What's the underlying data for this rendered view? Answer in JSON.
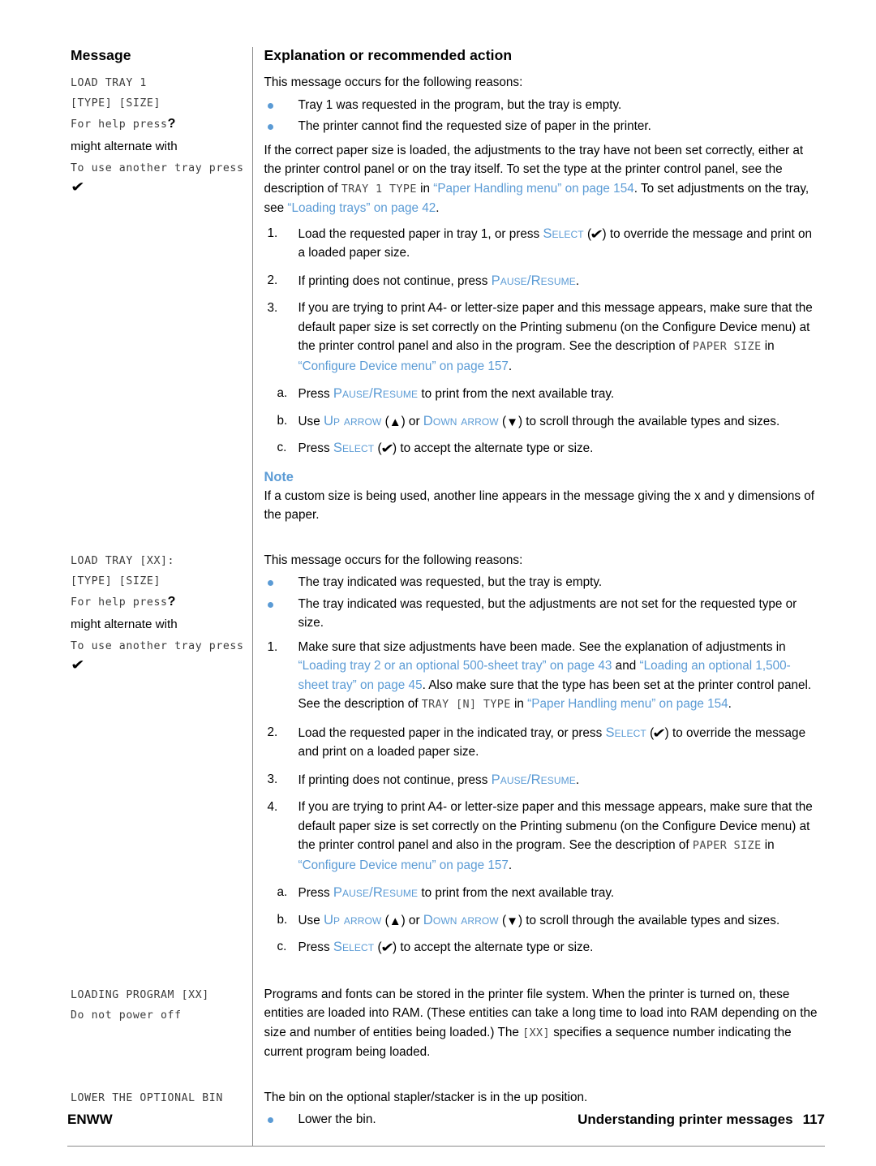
{
  "table": {
    "headers": {
      "message": "Message",
      "explanation": "Explanation or recommended action"
    }
  },
  "rows": [
    {
      "id": "load-tray-1",
      "message": {
        "lcd_line1": "LOAD TRAY 1",
        "lcd_line2": "[TYPE] [SIZE]",
        "lcd_line3": "For help press",
        "help_glyph": "?",
        "alternate_text": "might alternate with",
        "lcd_line4": "To use another tray press",
        "select_glyph": "✔"
      },
      "intro": "This message occurs for the following reasons:",
      "bullets": [
        "Tray 1 was requested in the program, but the tray is empty.",
        "The printer cannot find the requested size of paper in the printer."
      ],
      "para1_a": "If the correct paper size is loaded, the adjustments to the tray have not been set correctly, either at the printer control panel or on the tray itself. To set the type at the printer control panel, see the description of ",
      "para1_mono": "TRAY 1 TYPE",
      "para1_b": " in ",
      "para1_link1": "“Paper Handling menu” on page 154",
      "para1_c": ". To set adjustments on the tray, see ",
      "para1_link2": "“Loading trays” on page 42",
      "para1_d": ".",
      "steps": [
        {
          "num": "1.",
          "pre": "Load the requested paper in tray 1, or press ",
          "key": "Select",
          "glyph": "✔",
          "post": " to override the message and print on a loaded paper size."
        },
        {
          "num": "2.",
          "pre": "If printing does not continue, press ",
          "key": "Pause/Resume",
          "post": "."
        },
        {
          "num": "3.",
          "text_a": "If you are trying to print A4- or letter-size paper and this message appears, make sure that the default paper size is set correctly on the Printing submenu (on the Configure Device menu) at the printer control panel and also in the program. See the description of ",
          "mono": "PAPER SIZE",
          "text_b": " in ",
          "link": "“Configure Device menu” on page 157",
          "text_c": "."
        }
      ],
      "substeps": [
        {
          "num": "a.",
          "pre": "Press ",
          "key": "Pause/Resume",
          "post": " to print from the next available tray."
        },
        {
          "num": "b.",
          "pre": "Use ",
          "key1": "Up arrow",
          "glyph1": "▲",
          "mid": " or ",
          "key2": "Down arrow",
          "glyph2": "▼",
          "post": " to scroll through the available types and sizes."
        },
        {
          "num": "c.",
          "pre": "Press ",
          "key": "Select",
          "glyph": "✔",
          "post": " to accept the alternate type or size."
        }
      ],
      "note_heading": "Note",
      "note_body": "If a custom size is being used, another line appears in the message giving the x and y dimensions of the paper."
    },
    {
      "id": "load-tray-xx",
      "message": {
        "lcd_line1": "LOAD TRAY [XX]:",
        "lcd_line2": "[TYPE] [SIZE]",
        "lcd_line3": "For help press",
        "help_glyph": "?",
        "alternate_text": "might alternate with",
        "lcd_line4": "To use another tray press",
        "select_glyph": "✔"
      },
      "intro": "This message occurs for the following reasons:",
      "bullets": [
        "The tray indicated was requested, but the tray is empty.",
        "The tray indicated was requested, but the adjustments are not set for the requested type or size."
      ],
      "steps": [
        {
          "num": "1.",
          "text_a": "Make sure that size adjustments have been made. See the explanation of adjustments in ",
          "link1": "“Loading tray 2 or an optional 500-sheet tray” on page 43",
          "text_b": " and ",
          "link2": "“Loading an optional 1,500-sheet tray” on page 45",
          "text_c": ". Also make sure that the type has been set at the printer control panel. See the description of ",
          "mono": "TRAY [N] TYPE",
          "text_d": " in ",
          "link3": "“Paper Handling menu” on page 154",
          "text_e": "."
        },
        {
          "num": "2.",
          "pre": "Load the requested paper in the indicated tray, or press ",
          "key": "Select",
          "glyph": "✔",
          "post": " to override the message and print on a loaded paper size."
        },
        {
          "num": "3.",
          "pre": "If printing does not continue, press ",
          "key": "Pause/Resume",
          "post": "."
        },
        {
          "num": "4.",
          "text_a": "If you are trying to print A4- or letter-size paper and this message appears, make sure that the default paper size is set correctly on the Printing submenu (on the Configure Device menu) at the printer control panel and also in the program. See the description of ",
          "mono": "PAPER SIZE",
          "text_b": " in ",
          "link": "“Configure Device menu” on page 157",
          "text_c": "."
        }
      ],
      "substeps": [
        {
          "num": "a.",
          "pre": "Press ",
          "key": "Pause/Resume",
          "post": " to print from the next available tray."
        },
        {
          "num": "b.",
          "pre": "Use ",
          "key1": "Up arrow",
          "glyph1": "▲",
          "mid": " or ",
          "key2": "Down arrow",
          "glyph2": "▼",
          "post": " to scroll through the available types and sizes."
        },
        {
          "num": "c.",
          "pre": "Press ",
          "key": "Select",
          "glyph": "✔",
          "post": " to accept the alternate type or size."
        }
      ]
    },
    {
      "id": "loading-program",
      "message": {
        "lcd_line1": "LOADING PROGRAM [XX]",
        "lcd_line2": "Do not power off"
      },
      "body_a": "Programs and fonts can be stored in the printer file system. When the printer is turned on, these entities are loaded into RAM. (These entities can take a long time to load into RAM depending on the size and number of entities being loaded.) The ",
      "body_mono": "[XX]",
      "body_b": " specifies a sequence number indicating the current program being loaded."
    },
    {
      "id": "lower-optional-bin",
      "message": {
        "lcd_line1": "LOWER THE OPTIONAL BIN"
      },
      "body": "The bin on the optional stapler/stacker is in the up position.",
      "bullets": [
        "Lower the bin."
      ]
    }
  ],
  "footer": {
    "left": "ENWW",
    "section": "Understanding printer messages",
    "page_number": "117"
  },
  "colors": {
    "link": "#5b9bd5",
    "bullet": "#5b9bd5",
    "rule": "#8a8a8a",
    "lcd_text": "#3b3b3b"
  }
}
